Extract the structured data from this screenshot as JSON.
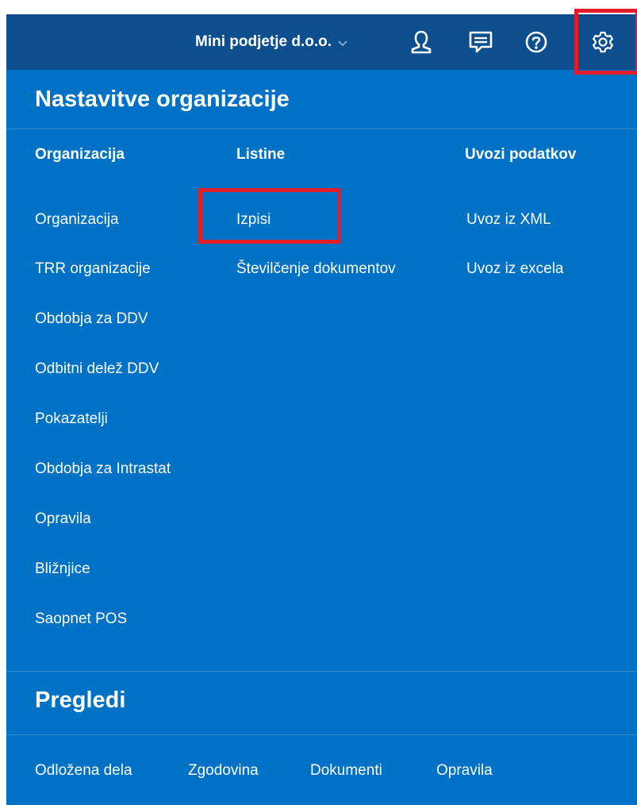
{
  "header": {
    "company_name": "Mini podjetje d.o.o.",
    "icons": [
      "user-icon",
      "messages-icon",
      "help-icon",
      "settings-icon"
    ]
  },
  "settings_menu": {
    "title": "Nastavitve organizacije",
    "columns": [
      {
        "heading": "Organizacija",
        "items": [
          "Organizacija",
          "TRR organizacije",
          "Obdobja za DDV",
          "Odbitni delež DDV",
          "Pokazatelji",
          "Obdobja za Intrastat",
          "Opravila",
          "Bližnjice",
          "Saopnet POS"
        ]
      },
      {
        "heading": "Listine",
        "items": [
          "Izpisi",
          "Številčenje dokumentov"
        ]
      },
      {
        "heading": "Uvozi podatkov",
        "items": [
          "Uvoz iz XML",
          "Uvoz iz excela"
        ]
      }
    ]
  },
  "views": {
    "title": "Pregledi",
    "items": [
      "Odložena dela",
      "Zgodovina",
      "Dokumenti",
      "Opravila"
    ]
  },
  "colors": {
    "panel_blue": "#0072c6",
    "topbar_blue": "#0d4f8e",
    "highlight_red": "#e31c2a",
    "text": "#ffffff"
  }
}
